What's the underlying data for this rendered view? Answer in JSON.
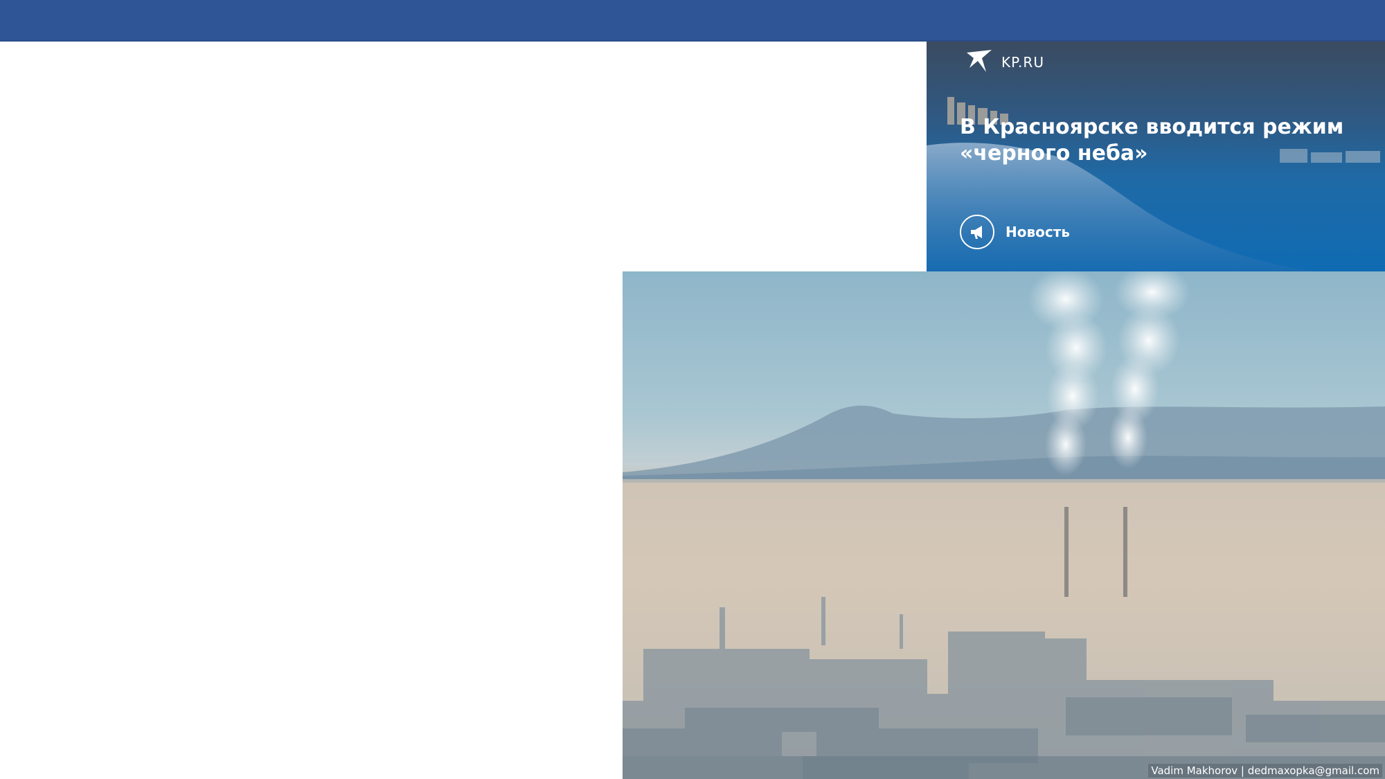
{
  "header": {
    "bar_color": "#2f5597"
  },
  "news_card": {
    "site": "KP.RU",
    "logo_icon": "swallow-bird-icon",
    "headline": "В Красноярске вводится режим «черного неба»",
    "badge_icon": "megaphone-icon",
    "badge_label": "Новость",
    "accent": "#0f6bb3"
  },
  "photo": {
    "description_icon": "smog-city-photo",
    "credit": "Vadim Makhorov | dedmaxopka@gmail.com"
  }
}
